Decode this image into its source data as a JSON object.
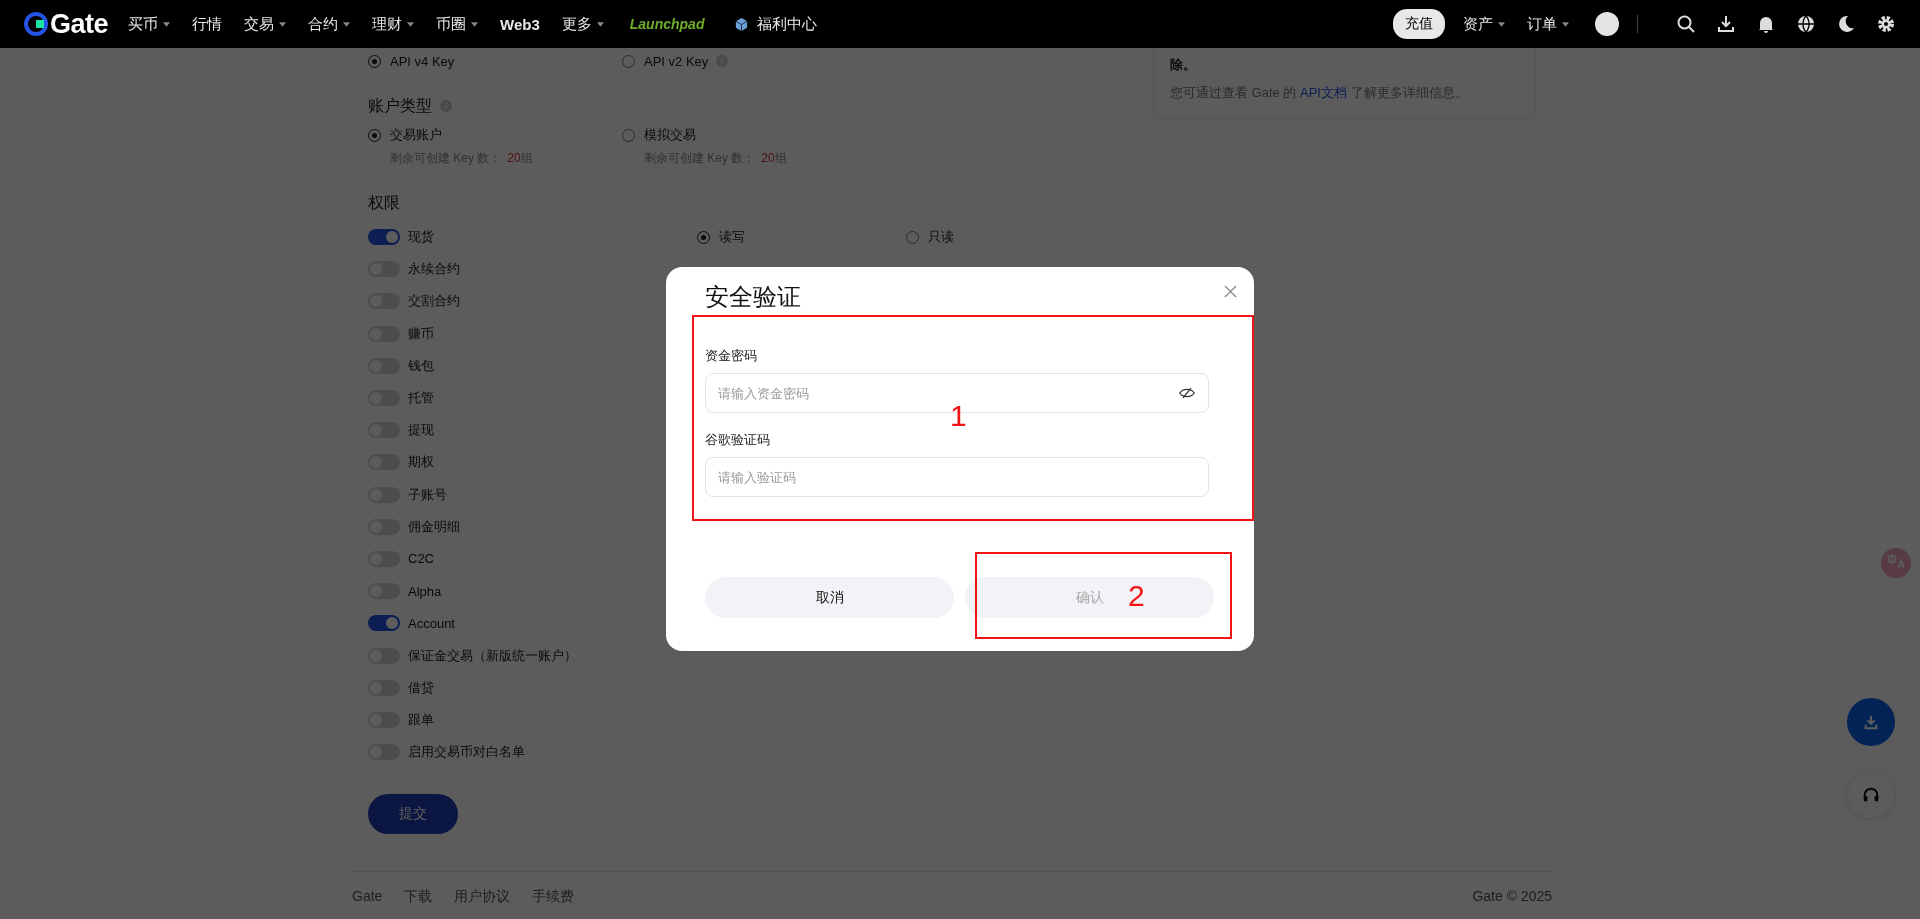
{
  "nav": {
    "logo": "Gate",
    "items": [
      {
        "label": "买币",
        "dropdown": true
      },
      {
        "label": "行情",
        "dropdown": false
      },
      {
        "label": "交易",
        "dropdown": true
      },
      {
        "label": "合约",
        "dropdown": true
      },
      {
        "label": "理财",
        "dropdown": true
      },
      {
        "label": "币圈",
        "dropdown": true
      },
      {
        "label": "Web3",
        "dropdown": false
      },
      {
        "label": "更多",
        "dropdown": true
      }
    ],
    "launchpad": "Launchpad",
    "welfare": "福利中心",
    "deposit": "充值",
    "right_menus": [
      {
        "label": "资产"
      },
      {
        "label": "订单"
      }
    ]
  },
  "api_versions": [
    {
      "label": "API v4 Key",
      "selected": true,
      "info": false
    },
    {
      "label": "API v2 Key",
      "selected": false,
      "info": true
    }
  ],
  "account_type": {
    "title": "账户类型",
    "options": [
      {
        "label": "交易账户",
        "selected": true,
        "note": "剩余可创建 Key 数：",
        "count": "20",
        "unit": "组"
      },
      {
        "label": "模拟交易",
        "selected": false,
        "note": "剩余可创建 Key 数：",
        "count": "20",
        "unit": "组"
      }
    ]
  },
  "permissions": {
    "title": "权限",
    "access": [
      {
        "label": "读写",
        "selected": true
      },
      {
        "label": "只读",
        "selected": false
      }
    ],
    "items": [
      {
        "label": "现货",
        "on": true
      },
      {
        "label": "永续合约",
        "on": false
      },
      {
        "label": "交割合约",
        "on": false
      },
      {
        "label": "赚币",
        "on": false
      },
      {
        "label": "钱包",
        "on": false
      },
      {
        "label": "托管",
        "on": false
      },
      {
        "label": "提现",
        "on": false
      },
      {
        "label": "期权",
        "on": false
      },
      {
        "label": "子账号",
        "on": false
      },
      {
        "label": "佣金明细",
        "on": false
      },
      {
        "label": "C2C",
        "on": false
      },
      {
        "label": "Alpha",
        "on": false
      },
      {
        "label": "Account",
        "on": true
      },
      {
        "label": "保证金交易（新版统一账户）",
        "on": false
      },
      {
        "label": "借贷",
        "on": false
      },
      {
        "label": "跟单",
        "on": false
      },
      {
        "label": "启用交易币对白名单",
        "on": false
      }
    ]
  },
  "submit": "提交",
  "info_panel": {
    "line": "除。",
    "before": "您可通过查看 Gate 的 ",
    "link": "API文档",
    "after": " 了解更多详细信息。"
  },
  "footer": {
    "links": [
      "Gate",
      "下载",
      "用户协议",
      "手续费"
    ],
    "copyright": "Gate © 2025"
  },
  "modal": {
    "title": "安全验证",
    "fields": [
      {
        "label": "资金密码",
        "placeholder": "请输入资金密码",
        "kind": "password"
      },
      {
        "label": "谷歌验证码",
        "placeholder": "请输入验证码",
        "kind": "text"
      }
    ],
    "cancel": "取消",
    "confirm": {
      "label": "确认",
      "disabled": true
    }
  },
  "annotations": [
    {
      "label": "1"
    },
    {
      "label": "2"
    }
  ]
}
